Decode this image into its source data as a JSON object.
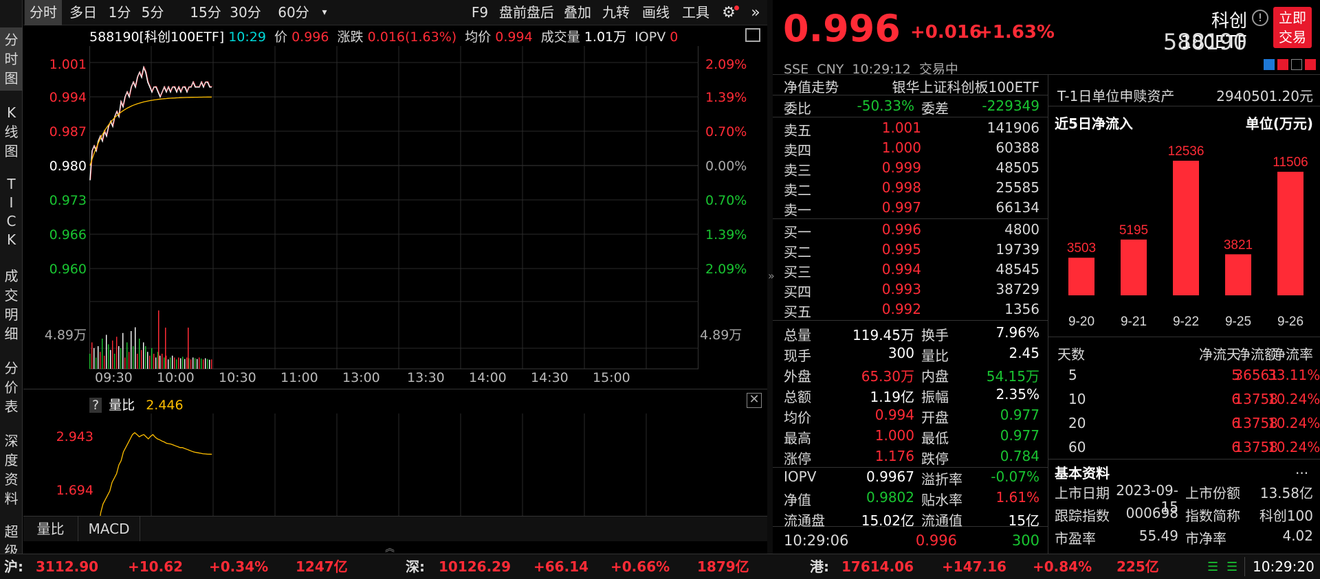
{
  "leftbar": {
    "items": [
      "分时图",
      "K线图",
      "TICK",
      "成交明细",
      "分价表",
      "深度资料",
      "超级"
    ]
  },
  "toolbar": {
    "tabs": [
      "分时",
      "多日",
      "1分",
      "5分",
      "15分",
      "30分",
      "60分"
    ],
    "dropdown": "▾",
    "tools": [
      "F9",
      "盘前盘后",
      "叠加",
      "九转",
      "画线",
      "工具"
    ],
    "settings_icon": "⚙",
    "expand_icon": "»"
  },
  "infobar": {
    "name": "588190[科创100ETF]",
    "time": "10:29",
    "price_label": "价",
    "price": "0.996",
    "change_label": "涨跌",
    "change": "0.016(1.63%)",
    "avg_label": "均价",
    "avg": "0.994",
    "vol_label": "成交量",
    "vol": "1.01万",
    "iopv_label": "IOPV",
    "iopv": "0"
  },
  "chart": {
    "yleft": [
      "1.001",
      "0.994",
      "0.987",
      "0.980",
      "0.973",
      "0.966",
      "0.960"
    ],
    "yright": [
      "2.09%",
      "1.39%",
      "0.70%",
      "0.00%",
      "0.70%",
      "1.39%",
      "2.09%"
    ],
    "vol_max": "4.89万",
    "xlabels": [
      "09:30",
      "10:00",
      "10:30",
      "11:00",
      "13:00",
      "13:30",
      "14:00",
      "14:30",
      "15:00"
    ]
  },
  "sub": {
    "help": "?",
    "title": "量比",
    "value": "2.446",
    "ymax": "2.943",
    "ymid": "1.694",
    "tabs": [
      "量比",
      "MACD"
    ]
  },
  "header": {
    "price": "0.996",
    "change": "+0.016",
    "pct": "+1.63%",
    "name": "科创100ETF",
    "code": "588190",
    "trade_btn_line1": "立即",
    "trade_btn_line2": "交易",
    "market": "SSE",
    "currency": "CNY",
    "time": "10:29:12",
    "status": "交易中"
  },
  "nav": {
    "label": "净值走势",
    "fund": "银华上证科创板100ETF"
  },
  "weibi": {
    "l1": "委比",
    "v1": "-50.33%",
    "l2": "委差",
    "v2": "-229349"
  },
  "sells": [
    [
      "卖五",
      "1.001",
      "141906"
    ],
    [
      "卖四",
      "1.000",
      "60388"
    ],
    [
      "卖三",
      "0.999",
      "48505"
    ],
    [
      "卖二",
      "0.998",
      "25585"
    ],
    [
      "卖一",
      "0.997",
      "66134"
    ]
  ],
  "buys": [
    [
      "买一",
      "0.996",
      "4800"
    ],
    [
      "买二",
      "0.995",
      "19739"
    ],
    [
      "买三",
      "0.994",
      "48545"
    ],
    [
      "买四",
      "0.993",
      "38729"
    ],
    [
      "买五",
      "0.992",
      "1356"
    ]
  ],
  "stats": [
    [
      "总量",
      "119.45万",
      "换手",
      "7.96%"
    ],
    [
      "现手",
      "300",
      "量比",
      "2.45"
    ],
    [
      "外盘",
      "65.30万",
      "内盘",
      "54.15万"
    ],
    [
      "总额",
      "1.19亿",
      "振幅",
      "2.35%"
    ],
    [
      "均价",
      "0.994",
      "开盘",
      "0.977"
    ],
    [
      "最高",
      "1.000",
      "最低",
      "0.977"
    ],
    [
      "涨停",
      "1.176",
      "跌停",
      "0.784"
    ]
  ],
  "iopv": [
    [
      "IOPV",
      "0.9967",
      "溢折率",
      "-0.07%"
    ],
    [
      "净值",
      "0.9802",
      "贴水率",
      "1.61%"
    ],
    [
      "流通盘",
      "15.02亿",
      "流通值",
      "15亿"
    ]
  ],
  "tick": {
    "time": "10:29:06",
    "price": "0.996",
    "vol": "300"
  },
  "flow": {
    "t1_label": "T-1日单位申赎资产",
    "t1_value": "2940501.20元",
    "title": "近5日净流入",
    "unit": "单位(万元)",
    "dates": [
      "9-20",
      "9-21",
      "9-22",
      "9-25",
      "9-26"
    ],
    "values": [
      3503,
      5195,
      12536,
      3821,
      11506
    ],
    "headers": [
      "天数",
      "净流天",
      "净流额",
      "净流率"
    ],
    "rows": [
      [
        "5",
        "5",
        "36561",
        "33.11%"
      ],
      [
        "10",
        "6",
        "13758",
        "10.24%"
      ],
      [
        "20",
        "6",
        "13758",
        "10.24%"
      ],
      [
        "60",
        "6",
        "13758",
        "10.24%"
      ]
    ]
  },
  "basic": {
    "title": "基本资料",
    "more": "...",
    "rows": [
      [
        "上市日期",
        "2023-09-15",
        "上市份额",
        "13.58亿"
      ],
      [
        "跟踪指数",
        "000698",
        "指数简称",
        "科创100"
      ],
      [
        "市盈率",
        "55.49",
        "市净率",
        "4.02"
      ]
    ]
  },
  "bottom": {
    "sh_label": "沪:",
    "sh": [
      "3112.90",
      "+10.62",
      "+0.34%",
      "1247亿"
    ],
    "sz_label": "深:",
    "sz": [
      "10126.29",
      "+66.14",
      "+0.66%",
      "1879亿"
    ],
    "hk_label": "港:",
    "hk": [
      "17614.06",
      "+147.16",
      "+0.84%",
      "225亿"
    ],
    "clock": "10:29:20"
  }
}
